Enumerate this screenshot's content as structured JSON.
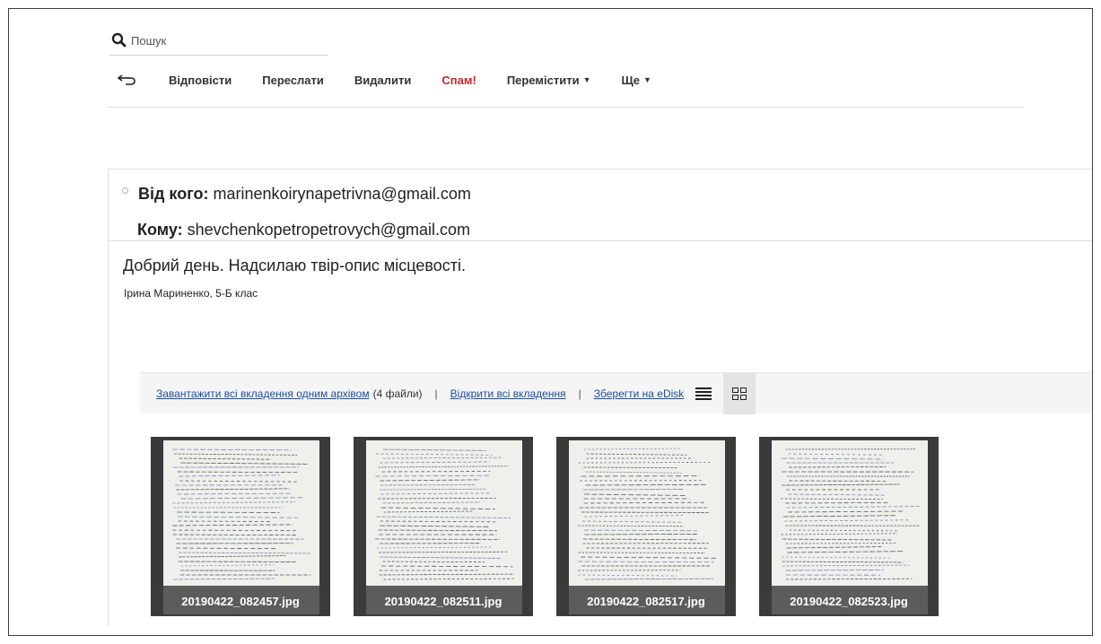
{
  "search": {
    "placeholder": "Пошук"
  },
  "toolbar": {
    "reply": "Відповісти",
    "forward": "Переслати",
    "delete": "Видалити",
    "spam": "Спам!",
    "move": "Перемістити",
    "more": "Ще"
  },
  "message": {
    "from_label": "Від кого:",
    "from_value": "marinenkoirynapetrivna@gmail.com",
    "to_label": "Кому:",
    "to_value": "shevchenkopetropetrovych@gmail.com",
    "body_line1": "Добрий день. Надсилаю твір-опис місцевості.",
    "body_line2": "Ірина Мариненко, 5-Б клас"
  },
  "attachments": {
    "download_all": "Завантажити всі вкладення одним архівом",
    "download_count": "(4 файли)",
    "separator": "|",
    "open_all": "Відкрити всі вкладення",
    "save_edisk": "Зберегти на eDisk",
    "files": [
      {
        "name": "20190422_082457.jpg"
      },
      {
        "name": "20190422_082511.jpg"
      },
      {
        "name": "20190422_082517.jpg"
      },
      {
        "name": "20190422_082523.jpg"
      }
    ]
  },
  "icons": {
    "search": "search-icon",
    "back": "back-arrow-icon",
    "list_view": "list-view-icon",
    "grid_view": "grid-view-icon"
  },
  "colors": {
    "link": "#1b4fa0",
    "spam": "#c62828",
    "attach_bar_bg": "#f5f5f5"
  }
}
